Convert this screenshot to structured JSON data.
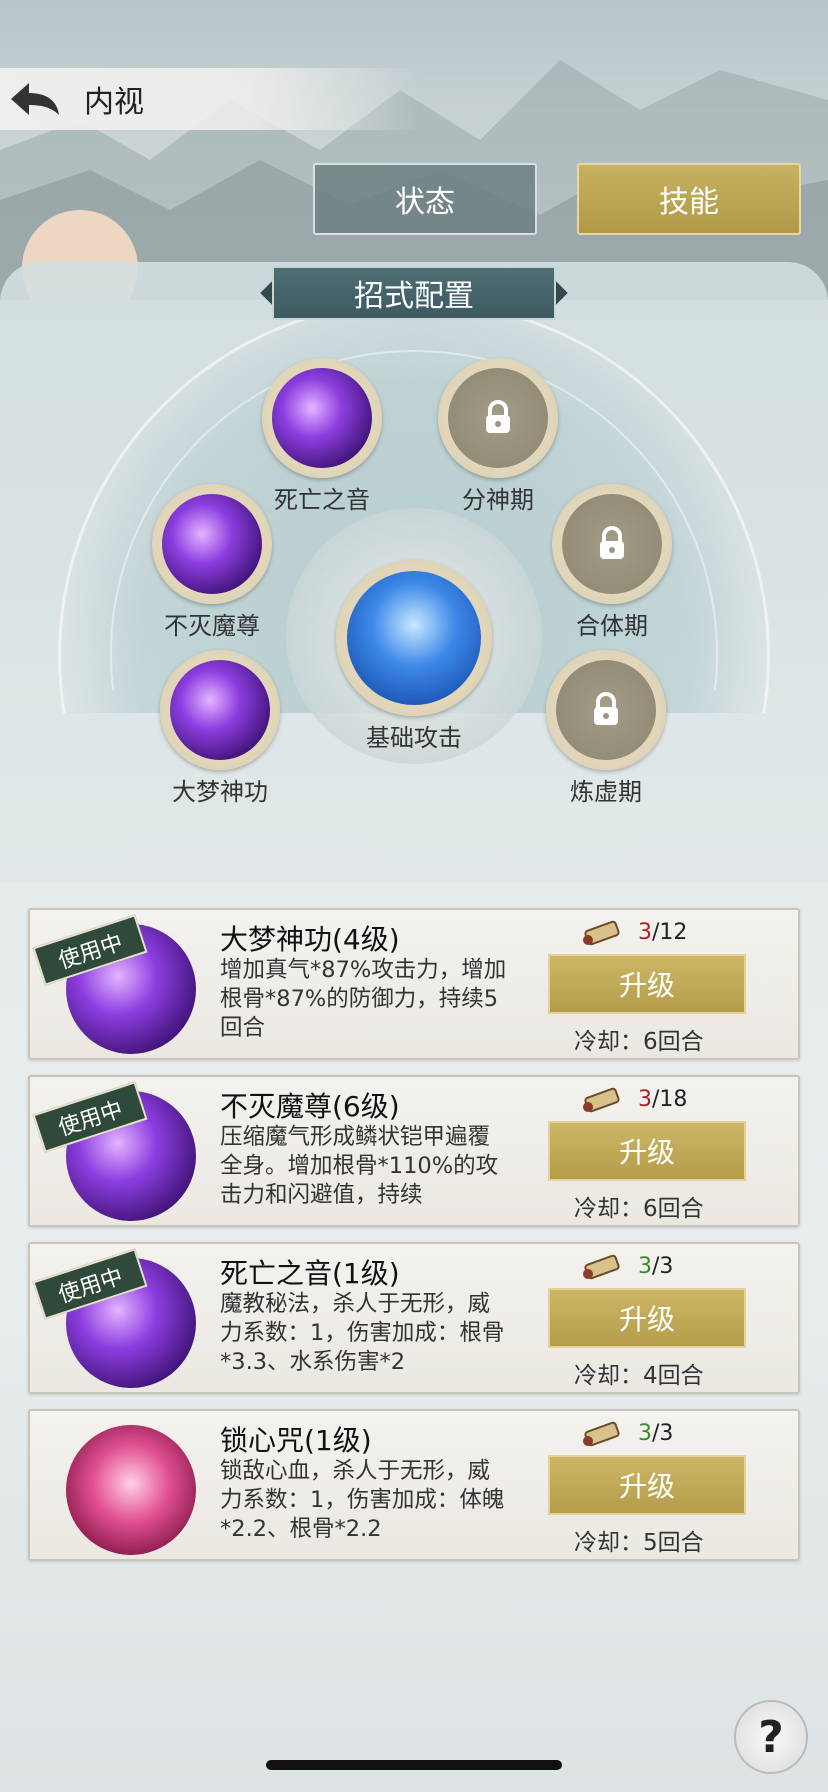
{
  "header": {
    "title": "内视"
  },
  "tabs": [
    {
      "label": "状态",
      "active": false
    },
    {
      "label": "技能",
      "active": true
    }
  ],
  "config": {
    "title": "招式配置",
    "slots": [
      {
        "label": "死亡之音",
        "locked": false,
        "icon": "death-sound-icon"
      },
      {
        "label": "分神期",
        "locked": true,
        "icon": "lock-icon"
      },
      {
        "label": "不灭魔尊",
        "locked": false,
        "icon": "demon-lord-icon"
      },
      {
        "label": "合体期",
        "locked": true,
        "icon": "lock-icon"
      },
      {
        "label": "基础攻击",
        "locked": false,
        "icon": "basic-attack-icon"
      },
      {
        "label": "大梦神功",
        "locked": false,
        "icon": "dream-eye-icon"
      },
      {
        "label": "炼虚期",
        "locked": true,
        "icon": "lock-icon"
      }
    ]
  },
  "skills": [
    {
      "name": "大梦神功(4级)",
      "badge": "使用中",
      "desc": "增加真气*87%攻击力，增加根骨*87%的防御力，持续5回合",
      "current": "3",
      "total": "/12",
      "current_color": "red",
      "upgrade_label": "升级",
      "cooldown": "冷却：6回合"
    },
    {
      "name": "不灭魔尊(6级)",
      "badge": "使用中",
      "desc": "压缩魔气形成鳞状铠甲遍覆全身。增加根骨*110%的攻击力和闪避值，持续",
      "current": "3",
      "total": "/18",
      "current_color": "red",
      "upgrade_label": "升级",
      "cooldown": "冷却：6回合"
    },
    {
      "name": "死亡之音(1级)",
      "badge": "使用中",
      "desc": "魔教秘法，杀人于无形，威力系数：1，伤害加成：根骨*3.3、水系伤害*2",
      "current": "3",
      "total": "/3",
      "current_color": "green",
      "upgrade_label": "升级",
      "cooldown": "冷却：4回合"
    },
    {
      "name": "锁心咒(1级)",
      "badge": "",
      "desc": "锁敌心血，杀人于无形，威力系数：1，伤害加成：体魄*2.2、根骨*2.2",
      "current": "3",
      "total": "/3",
      "current_color": "green",
      "upgrade_label": "升级",
      "cooldown": "冷却：5回合"
    }
  ],
  "help": {
    "label": "?"
  }
}
